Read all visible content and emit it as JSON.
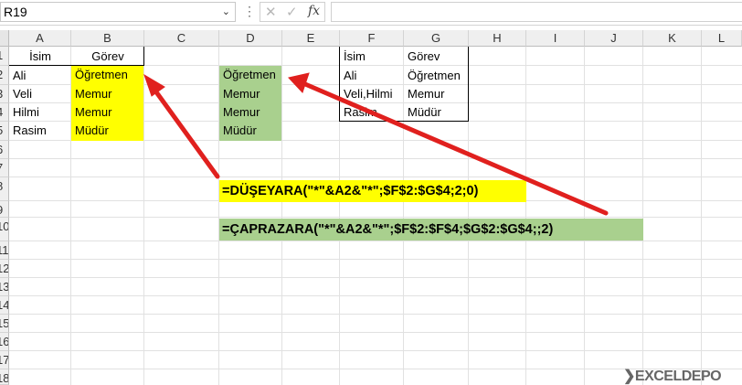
{
  "formula_bar": {
    "name_box": "R19",
    "name_box_dropdown_icon": "chevron-down-icon",
    "cancel_icon": "cancel-x-icon",
    "enter_icon": "checkmark-icon",
    "fx_label": "fx",
    "formula_value": ""
  },
  "columns": [
    "A",
    "B",
    "C",
    "D",
    "E",
    "F",
    "G",
    "H",
    "I",
    "J",
    "K",
    "L"
  ],
  "rows": [
    "1",
    "2",
    "3",
    "4",
    "5",
    "6",
    "7",
    "8",
    "9",
    "10",
    "11",
    "12",
    "13",
    "14",
    "15",
    "16",
    "17",
    "18"
  ],
  "cells": {
    "A1": "İsim",
    "B1": "Görev",
    "A2": "Ali",
    "B2": "Öğretmen",
    "A3": "Veli",
    "B3": "Memur",
    "A4": "Hilmi",
    "B4": "Memur",
    "A5": "Rasim",
    "B5": "Müdür",
    "D2": "Öğretmen",
    "D3": "Memur",
    "D4": "Memur",
    "D5": "Müdür",
    "F1": "İsim",
    "G1": "Görev",
    "F2": "Ali",
    "G2": "Öğretmen",
    "F3": "Veli,Hilmi",
    "G3": "Memur",
    "F4": "Rasim",
    "G4": "Müdür"
  },
  "formulas": {
    "vlookup": "=DÜŞEYARA(\"*\"&A2&\"*\";$F$2:$G$4;2;0)",
    "xlookup": "=ÇAPRAZARA(\"*\"&A2&\"*\";$F$2:$F$4;$G$2:$G$4;;2)"
  },
  "colors": {
    "yellow_fill": "#ffff00",
    "green_fill": "#a9d08e",
    "arrow": "#e0201e"
  },
  "watermark": "EXCELDEPO"
}
